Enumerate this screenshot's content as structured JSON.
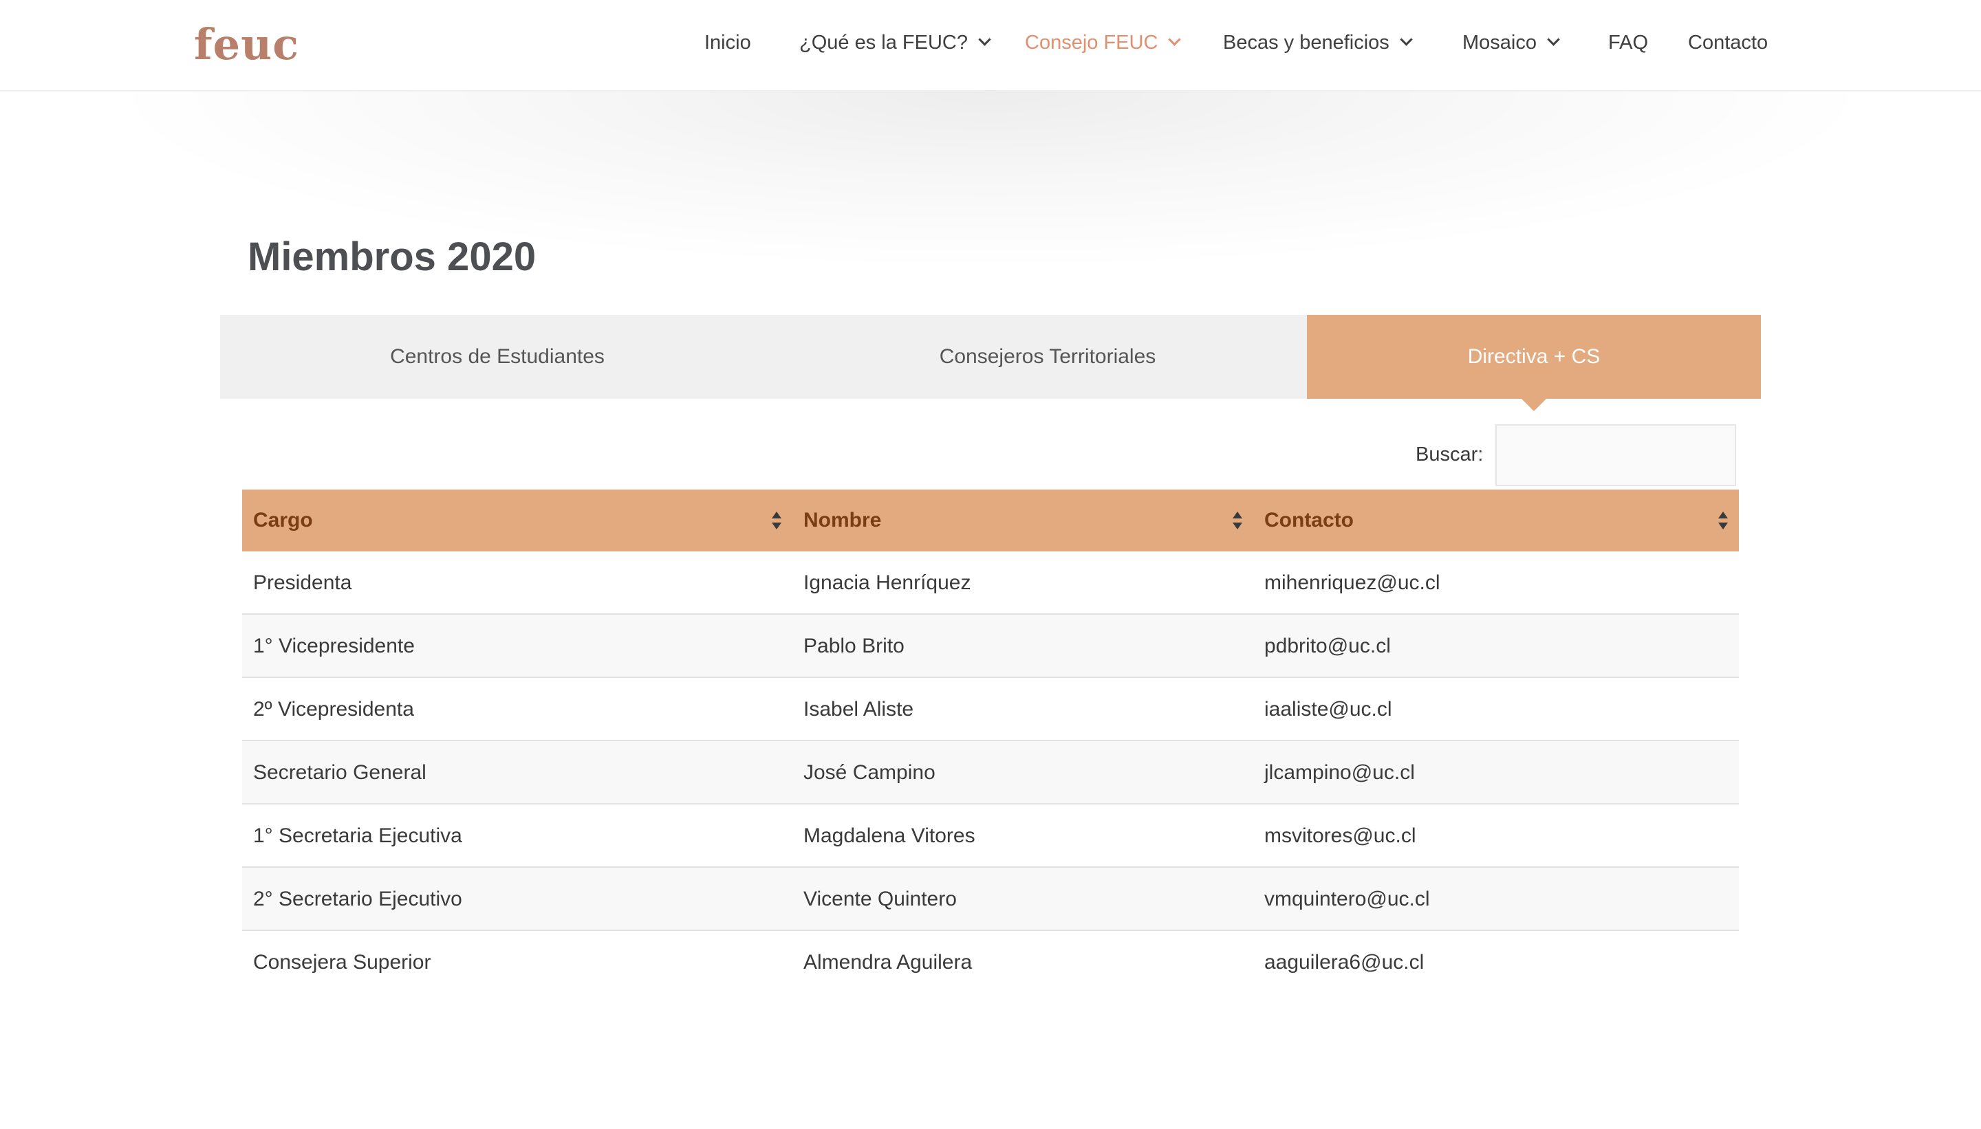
{
  "brand": {
    "logo_text": "feuc"
  },
  "nav": {
    "items": [
      {
        "label": "Inicio",
        "dropdown": false,
        "active": false
      },
      {
        "label": "¿Qué es la FEUC?",
        "dropdown": true,
        "active": false
      },
      {
        "label": "Consejo FEUC",
        "dropdown": true,
        "active": true
      },
      {
        "label": "Becas y beneficios",
        "dropdown": true,
        "active": false
      },
      {
        "label": "Mosaico",
        "dropdown": true,
        "active": false
      },
      {
        "label": "FAQ",
        "dropdown": false,
        "active": false
      },
      {
        "label": "Contacto",
        "dropdown": false,
        "active": false
      }
    ]
  },
  "main": {
    "title": "Miembros 2020",
    "tabs": [
      {
        "label": "Centros de Estudiantes",
        "active": false
      },
      {
        "label": "Consejeros Territoriales",
        "active": false
      },
      {
        "label": "Directiva + CS",
        "active": true
      }
    ],
    "search": {
      "label": "Buscar:",
      "value": "",
      "placeholder": ""
    },
    "table": {
      "columns": [
        "Cargo",
        "Nombre",
        "Contacto"
      ],
      "rows": [
        [
          "Presidenta",
          "Ignacia Henríquez",
          "mihenriquez@uc.cl"
        ],
        [
          "1° Vicepresidente",
          "Pablo Brito",
          "pdbrito@uc.cl"
        ],
        [
          "2º Vicepresidenta",
          "Isabel Aliste",
          "iaaliste@uc.cl"
        ],
        [
          "Secretario General",
          "José Campino",
          "jlcampino@uc.cl"
        ],
        [
          "1° Secretaria Ejecutiva",
          "Magdalena Vitores",
          "msvitores@uc.cl"
        ],
        [
          "2° Secretario Ejecutivo",
          "Vicente Quintero",
          "vmquintero@uc.cl"
        ],
        [
          "Consejera Superior",
          "Almendra Aguilera",
          "aaguilera6@uc.cl"
        ]
      ]
    }
  },
  "colors": {
    "accent": "#e3aa7f",
    "header_text": "#7a3e12",
    "nav_active": "#e08f6f",
    "logo": "#b8806a"
  }
}
